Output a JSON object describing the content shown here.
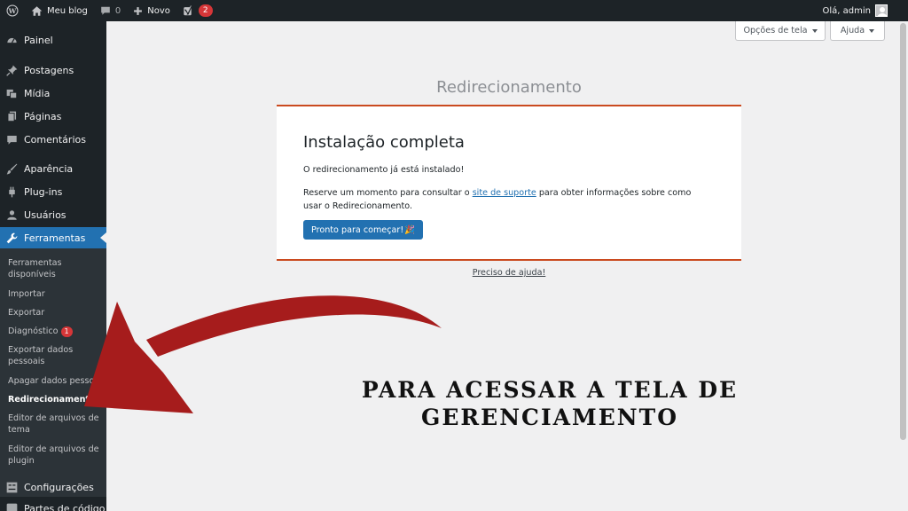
{
  "admin_bar": {
    "site_name": "Meu blog",
    "comments_count": "0",
    "new_label": "Novo",
    "yoast_badge": "2",
    "greeting": "Olá, admin"
  },
  "sidebar": {
    "painel": "Painel",
    "postagens": "Postagens",
    "midia": "Mídia",
    "paginas": "Páginas",
    "comentarios": "Comentários",
    "aparencia": "Aparência",
    "plugins": "Plug-ins",
    "usuarios": "Usuários",
    "ferramentas": "Ferramentas",
    "configuracoes": "Configurações",
    "partes_codigo": "Partes de código"
  },
  "submenu": {
    "ferramentas_disponiveis": "Ferramentas disponíveis",
    "importar": "Importar",
    "exportar": "Exportar",
    "diagnostico": "Diagnóstico",
    "diagnostico_badge": "1",
    "exportar_dados": "Exportar dados pessoais",
    "apagar_dados": "Apagar dados pessoais",
    "redirecionamento": "Redirecionamento",
    "editor_tema": "Editor de arquivos de tema",
    "editor_plugin": "Editor de arquivos de plugin"
  },
  "screen_meta": {
    "options_label": "Opções de tela",
    "help_label": "Ajuda"
  },
  "main": {
    "page_title": "Redirecionamento",
    "card_title": "Instalação completa",
    "installed_msg": "O redirecionamento já está instalado!",
    "support_prefix": "Reserve um momento para consultar o ",
    "support_link": "site de suporte",
    "support_suffix": " para obter informações sobre como usar o Redirecionamento.",
    "start_button": "Pronto para começar!",
    "start_emoji": "🎉",
    "help_link": "Preciso de ajuda!"
  },
  "annotation": {
    "line1": "PARA ACESSAR A TELA DE",
    "line2": "GERENCIAMENTO"
  },
  "colors": {
    "accent": "#2271b1",
    "admin_dark": "#1d2327",
    "card_border": "#ca4a1f",
    "arrow": "#a61c1c"
  }
}
